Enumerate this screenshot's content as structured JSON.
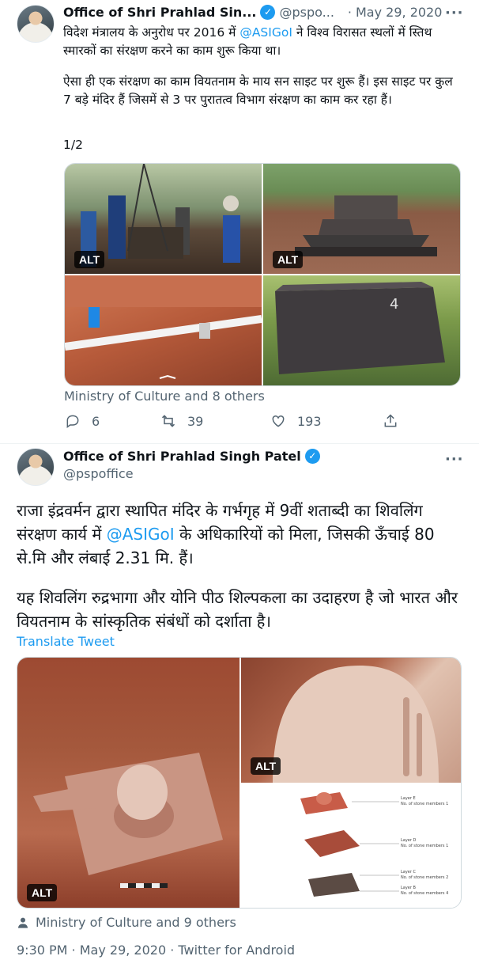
{
  "tweet1": {
    "display_name": "Office of Shri Prahlad Sin...",
    "handle": "@pspo...",
    "separator": "·",
    "date": "May 29, 2020",
    "text_before": "विदेश मंत्रालय के अनुरोध पर 2016 में ",
    "mention": "@ASIGoI",
    "text_after": " ने विश्व विरासत स्थलों में स्तिथ स्मारकों का संरक्षण करने का काम शुरू किया था।",
    "paragraph2": "ऐसा ही एक संरक्षण का काम वियतनाम के माय सन साइट पर शुरू हैं। इस साइट पर कुल 7 बड़े मंदिर हैं जिसमें से 3 पर पुरातत्व विभाग संरक्षण का काम कर रहा हैं।",
    "thread_marker": "1/2",
    "alt_label": "ALT",
    "tagged": "Ministry of Culture and 8 others",
    "replies": "6",
    "retweets": "39",
    "likes": "193"
  },
  "tweet2": {
    "display_name": "Office of Shri Prahlad Singh Patel",
    "handle": "@pspoffice",
    "text_before": "राजा इंद्रवर्मन द्वारा स्थापित मंदिर के गर्भगृह में 9वीं शताब्दी का शिवलिंग संरक्षण कार्य में ",
    "mention": "@ASIGoI",
    "text_after": " के अधिकारियों को मिला, जिसकी ऊँचाई 80 से.मि और लंबाई 2.31 मि. हैं।",
    "paragraph2": "यह शिवलिंग रुद्रभागा और योनि पीठ शिल्पकला का उदाहरण है जो भारत और वियतनाम के सांस्कृतिक संबंधों को दर्शाता है।",
    "translate": "Translate Tweet",
    "alt_label": "ALT",
    "diagram": {
      "layer_e": "Layer E",
      "layer_e_count": "No. of stone members 1",
      "layer_d": "Layer D",
      "layer_d_count": "No. of stone members 1",
      "layer_c": "Layer C",
      "layer_c_count": "No. of stone members 2",
      "layer_b": "Layer B",
      "layer_b_count": "No. of stone members 4"
    },
    "tagged": "Ministry of Culture and 9 others",
    "timestamp": "9:30 PM · May 29, 2020 · Twitter for Android"
  },
  "colors": {
    "accent": "#1d9bf0",
    "text": "#0f1419",
    "muted": "#536471"
  }
}
